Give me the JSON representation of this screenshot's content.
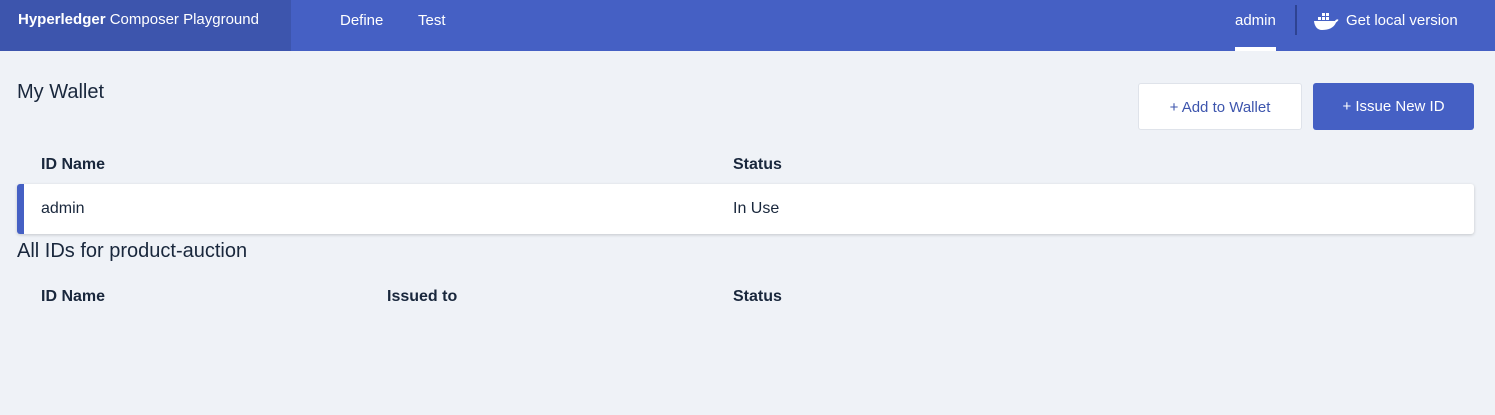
{
  "header": {
    "brand_bold": "Hyperledger",
    "brand_rest": " Composer Playground",
    "nav": {
      "define": "Define",
      "test": "Test"
    },
    "user": "admin",
    "local_version": "Get local version",
    "local_version_icon": "docker-whale-icon",
    "colors": {
      "bar": "#4560c4",
      "brand_bg": "#3d55ad"
    }
  },
  "wallet": {
    "title": "My Wallet",
    "add_button": "+ Add to Wallet",
    "issue_button": "+ Issue New ID",
    "columns": {
      "name": "ID Name",
      "status": "Status"
    },
    "rows": [
      {
        "name": "admin",
        "status": "In Use"
      }
    ]
  },
  "all_ids": {
    "title": "All IDs for product-auction",
    "columns": {
      "name": "ID Name",
      "issued_to": "Issued to",
      "status": "Status"
    },
    "rows": []
  }
}
